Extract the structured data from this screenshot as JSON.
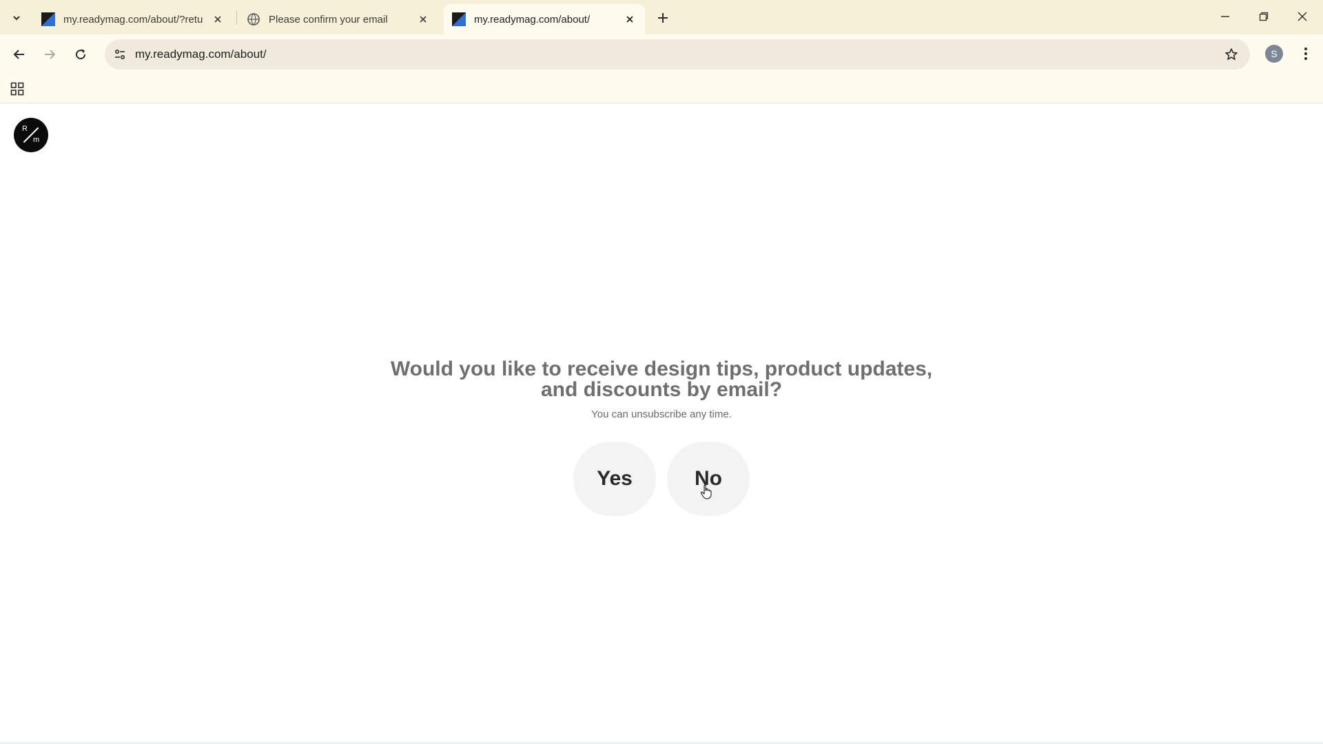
{
  "browser": {
    "tabs": [
      {
        "title": "my.readymag.com/about/?retu",
        "active": false,
        "favicon": "readymag-favicon"
      },
      {
        "title": "Please confirm your email",
        "active": false,
        "favicon": "globe-icon"
      },
      {
        "title": "my.readymag.com/about/",
        "active": true,
        "favicon": "readymag-favicon"
      }
    ],
    "url": "my.readymag.com/about/",
    "profile_initial": "S"
  },
  "page": {
    "logo": {
      "top": "R",
      "bottom": "m"
    },
    "question": "Would you like to receive design tips, product updates, and discounts by email?",
    "subnote": "You can unsubscribe any time.",
    "yes_label": "Yes",
    "no_label": "No"
  },
  "colors": {
    "tabstrip_bg": "#f6f0d9",
    "toolbar_bg": "#fffbee",
    "omnibox_bg": "#efeadb",
    "question_text": "#6f6f6f",
    "choice_bg": "#f3f3f3"
  }
}
